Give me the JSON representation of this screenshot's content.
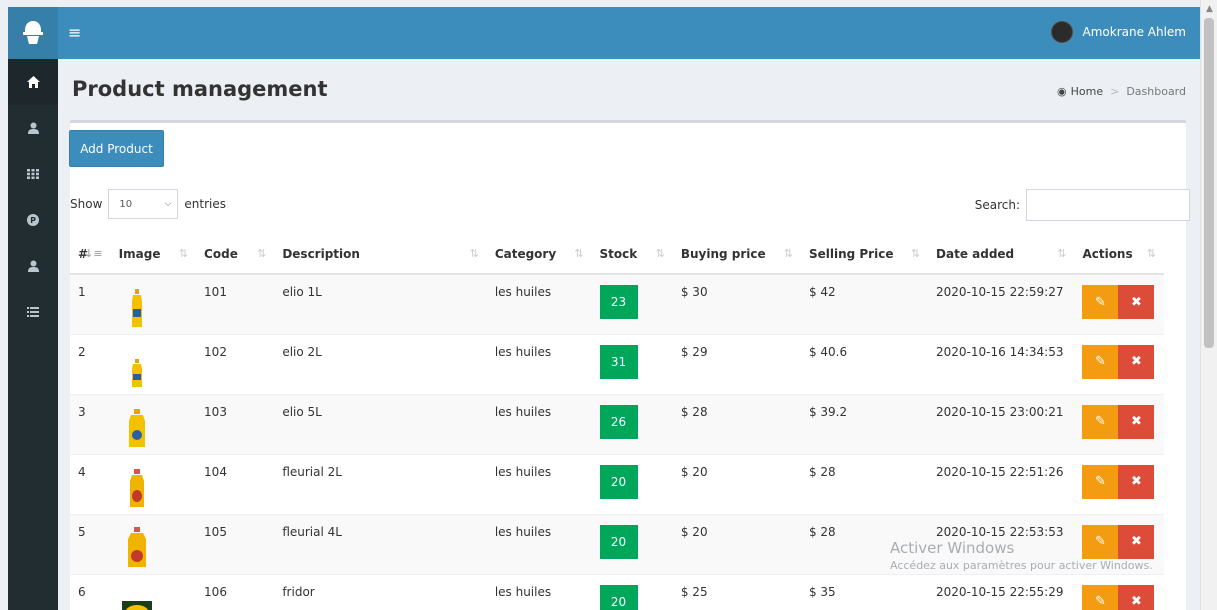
{
  "header": {
    "user_name": "Amokrane Ahlem"
  },
  "sidebar": {
    "items": [
      {
        "icon": "home-icon"
      },
      {
        "icon": "user-icon"
      },
      {
        "icon": "grid-icon"
      },
      {
        "icon": "parking-icon"
      },
      {
        "icon": "user-icon"
      },
      {
        "icon": "list-icon"
      }
    ]
  },
  "page": {
    "title": "Product management",
    "breadcrumb_home": "Home",
    "breadcrumb_current": "Dashboard"
  },
  "toolbar": {
    "add_label": "Add Product",
    "show_label": "Show",
    "entries_value": "10",
    "entries_label": "entries",
    "search_label": "Search:"
  },
  "table": {
    "columns": [
      "#",
      "Image",
      "Code",
      "Description",
      "Category",
      "Stock",
      "Buying price",
      "Selling Price",
      "Date added",
      "Actions"
    ],
    "rows": [
      {
        "n": "1",
        "code": "101",
        "description": "elio 1L",
        "category": "les huiles",
        "stock": "23",
        "buy": "$ 30",
        "sell": "$ 42",
        "date": "2020-10-15 22:59:27"
      },
      {
        "n": "2",
        "code": "102",
        "description": "elio 2L",
        "category": "les huiles",
        "stock": "31",
        "buy": "$ 29",
        "sell": "$ 40.6",
        "date": "2020-10-16 14:34:53"
      },
      {
        "n": "3",
        "code": "103",
        "description": "elio 5L",
        "category": "les huiles",
        "stock": "26",
        "buy": "$ 28",
        "sell": "$ 39.2",
        "date": "2020-10-15 23:00:21"
      },
      {
        "n": "4",
        "code": "104",
        "description": "fleurial 2L",
        "category": "les huiles",
        "stock": "20",
        "buy": "$ 20",
        "sell": "$ 28",
        "date": "2020-10-15 22:51:26"
      },
      {
        "n": "5",
        "code": "105",
        "description": "fleurial 4L",
        "category": "les huiles",
        "stock": "20",
        "buy": "$ 20",
        "sell": "$ 28",
        "date": "2020-10-15 22:53:53"
      },
      {
        "n": "6",
        "code": "106",
        "description": "fridor",
        "category": "les huiles",
        "stock": "20",
        "buy": "$ 25",
        "sell": "$ 35",
        "date": "2020-10-15 22:55:29"
      }
    ]
  },
  "watermark": {
    "title": "Activer Windows",
    "subtitle": "Accédez aux paramètres pour activer Windows."
  },
  "colors": {
    "header": "#3c8dbc",
    "sidebar": "#222d32",
    "stock_badge": "#00a65a",
    "edit": "#f39c12",
    "delete": "#dd4b39"
  }
}
